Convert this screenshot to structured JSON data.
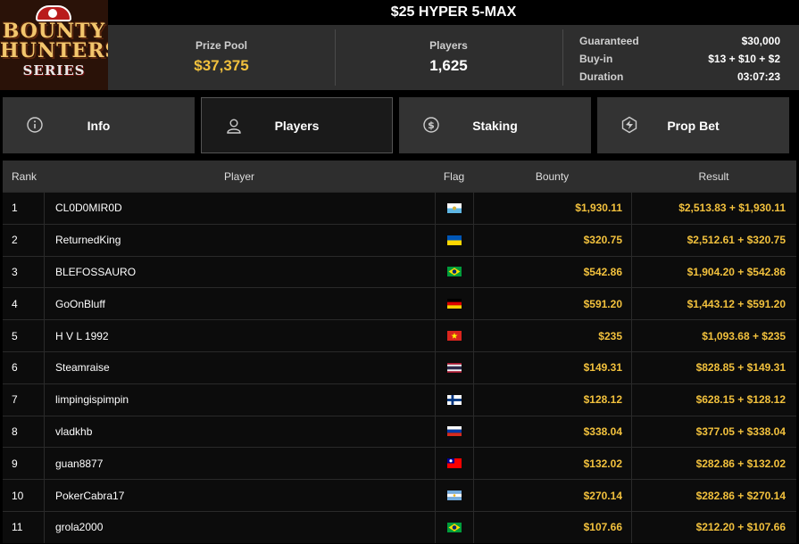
{
  "logo": {
    "line1": "BOUNTY",
    "line2": "HUNTERS",
    "line3": "SERIES"
  },
  "title": "$25 HYPER 5-MAX",
  "stats": {
    "prize_pool_label": "Prize Pool",
    "prize_pool_value": "$37,375",
    "players_label": "Players",
    "players_value": "1,625",
    "guaranteed_label": "Guaranteed",
    "guaranteed_value": "$30,000",
    "buyin_label": "Buy-in",
    "buyin_value": "$13 + $10 + $2",
    "duration_label": "Duration",
    "duration_value": "03:07:23"
  },
  "tabs": [
    {
      "label": "Info",
      "icon": "info-icon"
    },
    {
      "label": "Players",
      "icon": "user-icon",
      "active": true
    },
    {
      "label": "Staking",
      "icon": "dollar-coin-icon"
    },
    {
      "label": "Prop Bet",
      "icon": "prop-bet-icon"
    }
  ],
  "table": {
    "headers": {
      "rank": "Rank",
      "player": "Player",
      "flag": "Flag",
      "bounty": "Bounty",
      "result": "Result"
    },
    "rows": [
      {
        "rank": "1",
        "player": "CL0D0MIR0D",
        "flag": "san-marino",
        "bounty": "$1,930.11",
        "result": "$2,513.83 + $1,930.11"
      },
      {
        "rank": "2",
        "player": "ReturnedKing",
        "flag": "ukraine",
        "bounty": "$320.75",
        "result": "$2,512.61 + $320.75"
      },
      {
        "rank": "3",
        "player": "BLEFOSSAURO",
        "flag": "brazil",
        "bounty": "$542.86",
        "result": "$1,904.20 + $542.86"
      },
      {
        "rank": "4",
        "player": "GoOnBluff",
        "flag": "germany",
        "bounty": "$591.20",
        "result": "$1,443.12 + $591.20"
      },
      {
        "rank": "5",
        "player": "H V L 1992",
        "flag": "vietnam",
        "bounty": "$235",
        "result": "$1,093.68 + $235"
      },
      {
        "rank": "6",
        "player": "Steamraise",
        "flag": "thailand",
        "bounty": "$149.31",
        "result": "$828.85 + $149.31"
      },
      {
        "rank": "7",
        "player": "limpingispimpin",
        "flag": "finland",
        "bounty": "$128.12",
        "result": "$628.15 + $128.12"
      },
      {
        "rank": "8",
        "player": "vladkhb",
        "flag": "russia",
        "bounty": "$338.04",
        "result": "$377.05 + $338.04"
      },
      {
        "rank": "9",
        "player": "guan8877",
        "flag": "taiwan",
        "bounty": "$132.02",
        "result": "$282.86 + $132.02"
      },
      {
        "rank": "10",
        "player": "PokerCabra17",
        "flag": "argentina",
        "bounty": "$270.14",
        "result": "$282.86 + $270.14"
      },
      {
        "rank": "11",
        "player": "grola2000",
        "flag": "brazil",
        "bounty": "$107.66",
        "result": "$212.20 + $107.66"
      }
    ]
  },
  "colors": {
    "accent_gold": "#f2c13d",
    "panel": "#2e2e2e",
    "tab": "#333333",
    "background": "#000000"
  }
}
